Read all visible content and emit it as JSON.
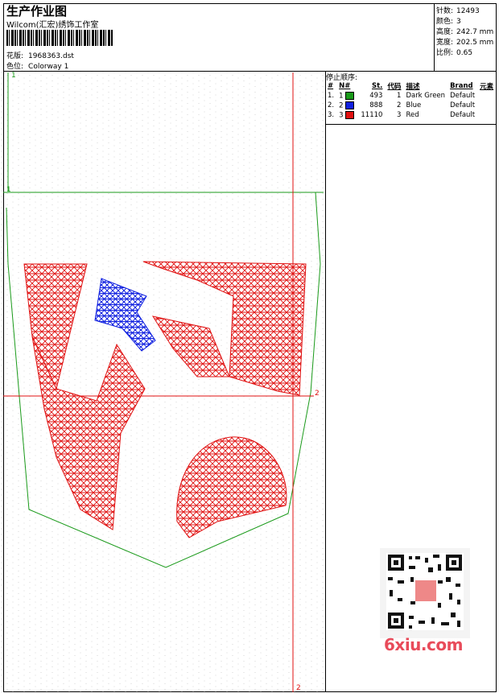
{
  "header": {
    "title": "生产作业图",
    "company": "Wilcom(汇宏)绣饰工作室",
    "design_label": "花版:",
    "design_value": "1968363.dst",
    "colorway_label": "色位:",
    "colorway_value": "Colorway 1"
  },
  "stats": [
    {
      "label": "针数:",
      "value": "12493"
    },
    {
      "label": "颜色:",
      "value": "3"
    },
    {
      "label": "高度:",
      "value": "242.7 mm"
    },
    {
      "label": "宽度:",
      "value": "202.5 mm"
    },
    {
      "label": "比例:",
      "value": "0.65"
    }
  ],
  "stop_sequence": {
    "title": "停止顺序:",
    "headers": [
      "#",
      "N#",
      "St.",
      "代码",
      "描述",
      "Brand",
      "元素"
    ],
    "rows": [
      {
        "idx": "1.",
        "n": "1",
        "stitches": "493",
        "code": "1",
        "desc": "Dark Green",
        "brand": "Default",
        "color": "#1a9a1a"
      },
      {
        "idx": "2.",
        "n": "2",
        "stitches": "888",
        "code": "2",
        "desc": "Blue",
        "brand": "Default",
        "color": "#1020e0"
      },
      {
        "idx": "3.",
        "n": "3",
        "stitches": "11110",
        "code": "3",
        "desc": "Red",
        "brand": "Default",
        "color": "#e01010"
      }
    ]
  },
  "design": {
    "marker_top_left": "1",
    "marker_left": "1",
    "marker_right": "2",
    "marker_bottom": "2",
    "thread_colors": {
      "green": "#1a9a1a",
      "blue": "#1020e0",
      "red": "#e01010"
    }
  },
  "watermark": "6xiu.com"
}
